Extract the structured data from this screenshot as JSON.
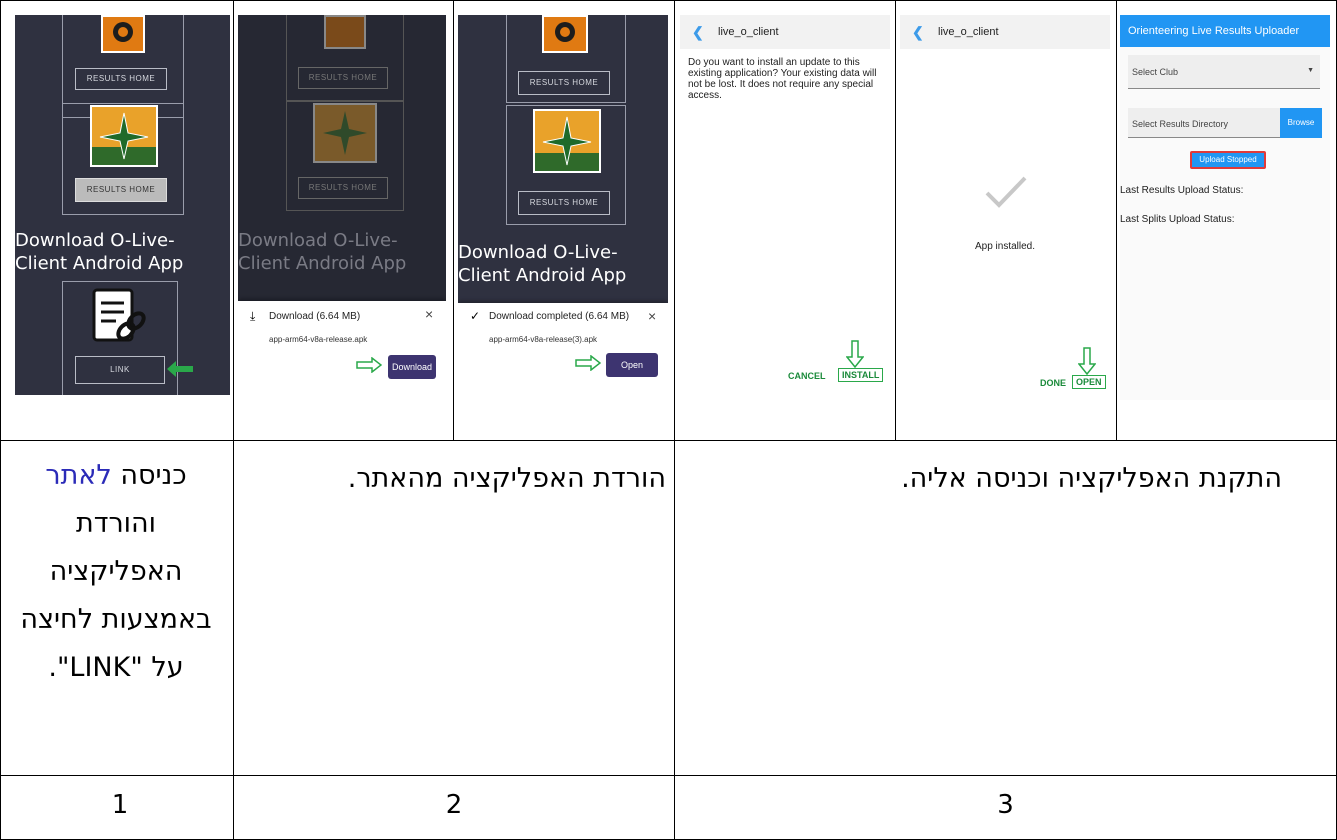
{
  "screens": {
    "s1": {
      "btn_results_home_a": "RESULTS HOME",
      "btn_results_home_b": "RESULTS HOME",
      "title": "Download O-Live-Client Android App",
      "link": "LINK"
    },
    "s2": {
      "btn_results_home_a": "RESULTS HOME",
      "btn_results_home_b": "RESULTS HOME",
      "title": "Download O-Live-Client Android App",
      "download_title": "Download (6.64 MB)",
      "file": "app-arm64-v8a-release.apk",
      "download_button": "Download"
    },
    "s3": {
      "btn_results_home_a": "RESULTS HOME",
      "btn_results_home_b": "RESULTS HOME",
      "title": "Download O-Live-Client Android App",
      "download_title": "Download completed (6.64 MB)",
      "file": "app-arm64-v8a-release(3).apk",
      "open_button": "Open"
    },
    "s4": {
      "app": "live_o_client",
      "message": "Do you want to install an update to this existing application? Your existing data will not be lost. It does not require any special access.",
      "cancel": "CANCEL",
      "install": "INSTALL"
    },
    "s5": {
      "app": "live_o_client",
      "installed": "App installed.",
      "done": "DONE",
      "open": "OPEN"
    },
    "s6": {
      "title": "Orienteering Live Results Uploader",
      "select_club": "Select Club",
      "select_dir": "Select Results Directory",
      "browse": "Browse",
      "upload": "Upload Stopped",
      "results_status": "Last Results Upload Status:",
      "splits_status": "Last Splits Upload Status:"
    }
  },
  "captions": {
    "c1_prefix": "כניסה ",
    "c1_link": "לאתר",
    "c1_rest": "והורדת האפליקציה באמצעות לחיצה על \"LINK\".",
    "c2": "הורדת האפליקציה מהאתר.",
    "c3": "התקנת האפליקציה וכניסה אליה."
  },
  "steps": [
    "1",
    "2",
    "3"
  ],
  "colors": {
    "dark_bg": "#2f3140",
    "orange": "#e07a12",
    "purple": "#3d3470",
    "blue_header": "#2196f3",
    "green": "#2aa84a",
    "link_blue": "#2b2bb8"
  }
}
